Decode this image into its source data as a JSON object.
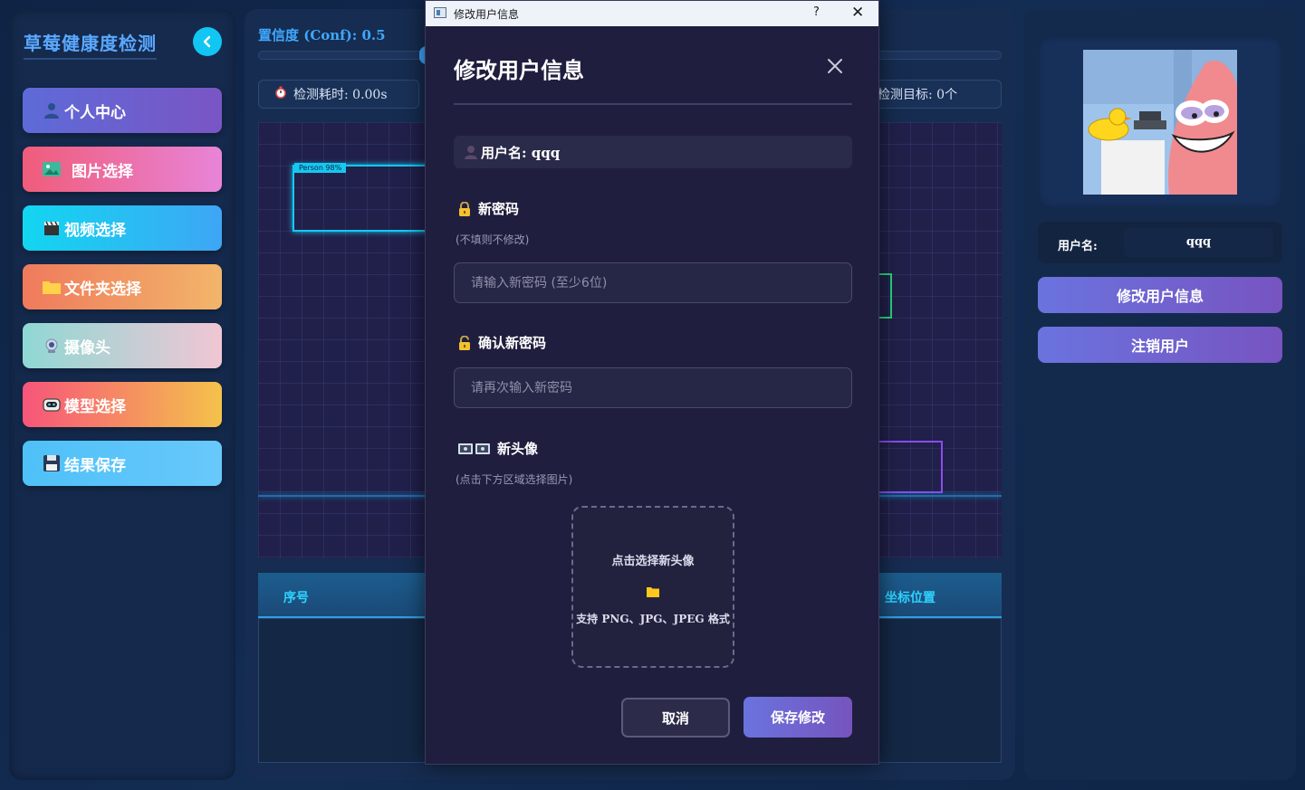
{
  "sidebar": {
    "brand": "草莓健康度检测",
    "items": [
      {
        "label": "个人中心",
        "icon": "user-icon"
      },
      {
        "label": "图片选择",
        "icon": "image-icon"
      },
      {
        "label": "视频选择",
        "icon": "clapper-icon"
      },
      {
        "label": "文件夹选择",
        "icon": "folder-icon"
      },
      {
        "label": "摄像头",
        "icon": "webcam-icon"
      },
      {
        "label": "模型选择",
        "icon": "robot-icon"
      },
      {
        "label": "结果保存",
        "icon": "floppy-icon"
      }
    ]
  },
  "main": {
    "confidence_label": "置信度 (Conf): 0.5",
    "confidence_value": 0.5,
    "elapsed_label": "检测耗时: 0.00s",
    "targets_label": "检测目标: 0个",
    "detection_tag": "Person 98%",
    "table_headers": {
      "index": "序号",
      "coords": "坐标位置"
    }
  },
  "profile": {
    "username_label": "用户名:",
    "username_value": "qqq",
    "edit_button": "修改用户信息",
    "logout_button": "注销用户"
  },
  "dialog": {
    "window_title": "修改用户信息",
    "help_glyph": "?",
    "close_glyph": "✕",
    "heading": "修改用户信息",
    "username_line": "用户名: qqq",
    "new_password_title": "新密码",
    "new_password_hint": "(不填则不修改)",
    "new_password_placeholder": "请输入新密码 (至少6位)",
    "confirm_password_title": "确认新密码",
    "confirm_password_placeholder": "请再次输入新密码",
    "avatar_title": "新头像",
    "avatar_hint": "(点击下方区域选择图片)",
    "upload_title": "点击选择新头像",
    "upload_formats": "支持 PNG、JPG、JPEG 格式",
    "cancel_button": "取消",
    "save_button": "保存修改"
  },
  "colors": {
    "accent": "#11c6f2",
    "dialog_bg": "#1f1e3e",
    "primary_gradient_start": "#6a73df",
    "primary_gradient_end": "#7654bd"
  }
}
